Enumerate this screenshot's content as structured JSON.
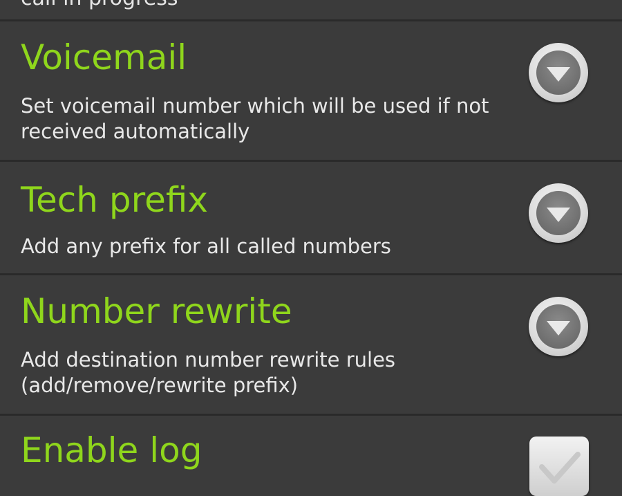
{
  "top_row": {
    "partial_text": "call in progress"
  },
  "settings": [
    {
      "title": "Voicemail",
      "summary": "Set voicemail number which will be used if not received automatically",
      "control": "dropdown-icon"
    },
    {
      "title": "Tech prefix",
      "summary": "Add any prefix for all called numbers",
      "control": "dropdown-icon"
    },
    {
      "title": "Number rewrite",
      "summary": "Add destination number rewrite rules (add/remove/rewrite prefix)",
      "control": "dropdown-icon"
    },
    {
      "title": "Enable log",
      "control": "checkbox-icon",
      "checked": true
    }
  ],
  "colors": {
    "background": "#3b3b3b",
    "title": "#8fd61c",
    "summary": "#e8e8e8",
    "divider": "#2a2a2a"
  }
}
